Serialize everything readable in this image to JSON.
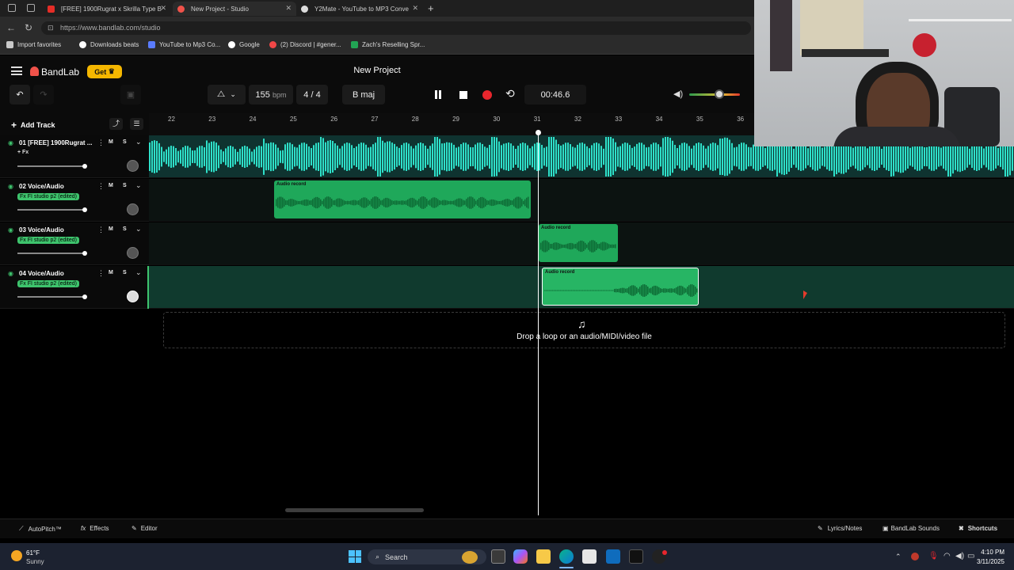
{
  "browser": {
    "tabs": [
      {
        "label": "[FREE] 1900Rugrat x Skrilla Type B",
        "color": "#e52d27"
      },
      {
        "label": "New Project - Studio",
        "color": "#f0524a"
      },
      {
        "label": "Y2Mate - YouTube to MP3 Conve",
        "color": "#dddddd"
      }
    ],
    "url": "https://www.bandlab.com/studio",
    "bookmarks": [
      {
        "label": "Import favorites",
        "color": "#c9c9c9"
      },
      {
        "label": "Downloads beats",
        "color": "#ffffff"
      },
      {
        "label": "YouTube to Mp3 Co...",
        "color": "#5a7cff"
      },
      {
        "label": "Google",
        "color": "#ffffff"
      },
      {
        "label": "(2) Discord | #gener...",
        "color": "#f04747"
      },
      {
        "label": "Zach's Reselling Spr...",
        "color": "#22a454"
      }
    ]
  },
  "app": {
    "logo": "BandLab",
    "get_label": "Get",
    "project_title": "New Project",
    "bpm_value": "155",
    "bpm_unit": "bpm",
    "time_signature": "4 / 4",
    "key": "B maj",
    "time": "00:46.6",
    "volume_level": 0.6,
    "accent": "#f5b700",
    "record_color": "#e8262d",
    "add_track_label": "Add Track",
    "ruler_ticks": [
      "22",
      "23",
      "24",
      "25",
      "26",
      "27",
      "28",
      "29",
      "30",
      "31",
      "32",
      "33",
      "34",
      "35",
      "36"
    ],
    "playhead_position_bar": 31,
    "tracks": [
      {
        "name": "01  [FREE] 1900Rugrat ...",
        "fx": "+ Fx",
        "mute": "M",
        "solo": "S",
        "clips": []
      },
      {
        "name": "02  Voice/Audio",
        "fx": "Fx FI studio p2 (edited)",
        "mute": "M",
        "solo": "S",
        "clips": [
          {
            "label": "Audio record"
          }
        ]
      },
      {
        "name": "03  Voice/Audio",
        "fx": "Fx FI studio p2 (edited)",
        "mute": "M",
        "solo": "S",
        "clips": [
          {
            "label": "Audio record"
          }
        ]
      },
      {
        "name": "04  Voice/Audio",
        "fx": "Fx FI studio p2 (edited)",
        "mute": "M",
        "solo": "S",
        "clips": [
          {
            "label": "Audio record"
          }
        ]
      }
    ],
    "drop_zone": "Drop a loop or an audio/MIDI/video file",
    "footer_left": [
      "AutoPitch™",
      "Effects",
      "Editor"
    ],
    "footer_right": [
      "Lyrics/Notes",
      "BandLab Sounds",
      "Shortcuts"
    ]
  },
  "taskbar": {
    "weather_temp": "61°F",
    "weather_desc": "Sunny",
    "search_label": "Search",
    "time": "4:10 PM",
    "date": "3/11/2025"
  }
}
